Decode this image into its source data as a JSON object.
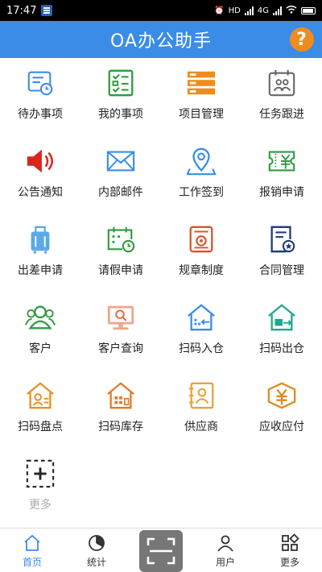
{
  "status": {
    "time": "17:47",
    "network": "HD",
    "signal": "4G"
  },
  "header": {
    "title": "OA办公助手",
    "help_glyph": "?"
  },
  "grid": [
    {
      "label": "待办事项",
      "icon": "todo-icon"
    },
    {
      "label": "我的事项",
      "icon": "checklist-icon"
    },
    {
      "label": "项目管理",
      "icon": "project-icon"
    },
    {
      "label": "任务跟进",
      "icon": "calendar-people-icon"
    },
    {
      "label": "公告通知",
      "icon": "speaker-icon"
    },
    {
      "label": "内部邮件",
      "icon": "mail-icon"
    },
    {
      "label": "工作签到",
      "icon": "location-pin-icon"
    },
    {
      "label": "报销申请",
      "icon": "yuan-ticket-icon"
    },
    {
      "label": "出差申请",
      "icon": "luggage-icon"
    },
    {
      "label": "请假申请",
      "icon": "calendar-clock-icon"
    },
    {
      "label": "规章制度",
      "icon": "rules-document-icon"
    },
    {
      "label": "合同管理",
      "icon": "contract-icon"
    },
    {
      "label": "客户",
      "icon": "customers-icon"
    },
    {
      "label": "客户查询",
      "icon": "monitor-search-icon"
    },
    {
      "label": "扫码入仓",
      "icon": "warehouse-in-icon"
    },
    {
      "label": "扫码出仓",
      "icon": "warehouse-out-icon"
    },
    {
      "label": "扫码盘点",
      "icon": "inventory-count-icon"
    },
    {
      "label": "扫码库存",
      "icon": "stock-icon"
    },
    {
      "label": "供应商",
      "icon": "supplier-icon"
    },
    {
      "label": "应收应付",
      "icon": "receivable-payable-icon"
    },
    {
      "label": "更多",
      "icon": "add-more-icon"
    }
  ],
  "tabs": {
    "home": "首页",
    "stats": "统计",
    "user": "用户",
    "more": "更多"
  },
  "colors": {
    "title_bar": "#3a8ce6",
    "help": "#f08c1e",
    "active_tab": "#3a8ce6",
    "scan_button": "#777777"
  }
}
